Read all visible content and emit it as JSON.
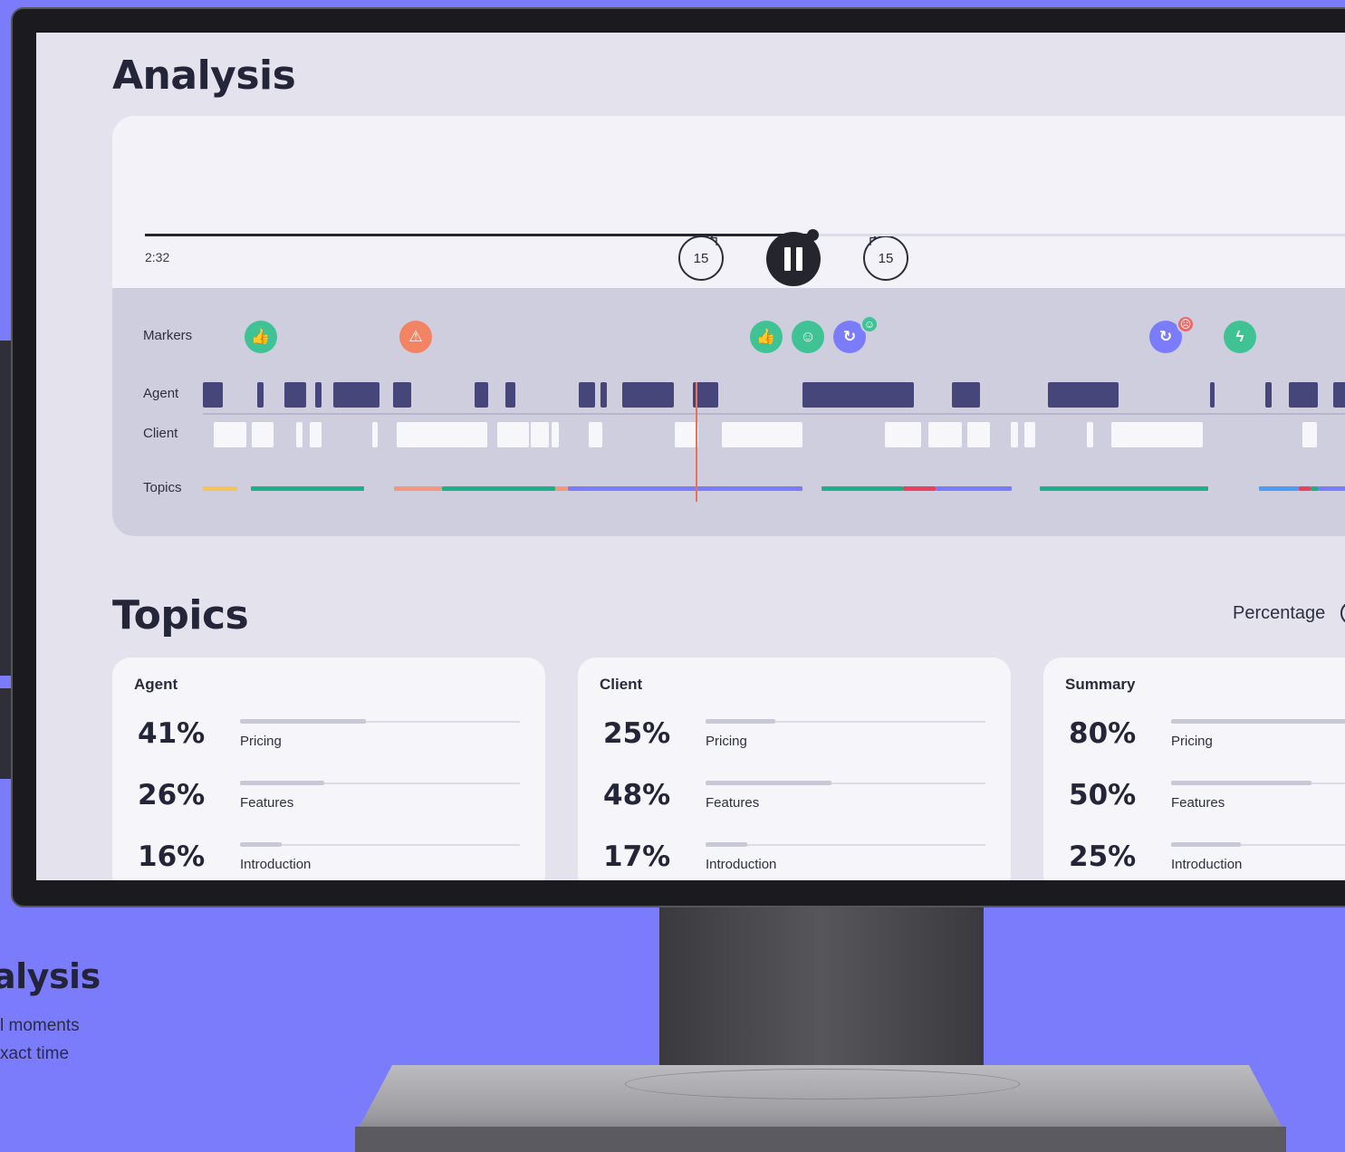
{
  "promo": {
    "title": "alysis",
    "lines": [
      "l moments",
      "xact time"
    ]
  },
  "page": {
    "title": "Analysis"
  },
  "player": {
    "skip_back_label": "15",
    "skip_forward_label": "15",
    "current_time": "2:32",
    "progress": 0.55
  },
  "timeline": {
    "labels": {
      "markers": "Markers",
      "agent": "Agent",
      "client": "Client",
      "topics": "Topics"
    },
    "markers": [
      {
        "icon": "thumbs-up-icon",
        "glyph": "👍",
        "color": "#3fc394"
      },
      {
        "icon": "warning-icon",
        "glyph": "⚠",
        "color": "#f38463"
      },
      {
        "icon": "thumbs-up-icon",
        "glyph": "👍",
        "color": "#3fc394"
      },
      {
        "icon": "happy-face-icon",
        "glyph": "☺",
        "color": "#3fc394"
      },
      {
        "icon": "sync-happy-icon",
        "glyph": "↻",
        "color": "#7b7cfb",
        "badge": "☺",
        "badge_color": "#3fc394"
      },
      {
        "icon": "sync-sad-icon",
        "glyph": "↻",
        "color": "#7b7cfb",
        "badge": "☹",
        "badge_color": "#f06565"
      },
      {
        "icon": "lightning-icon",
        "glyph": "ϟ",
        "color": "#3fc394"
      }
    ],
    "topic_colors": {
      "yellow": "#f4c35a",
      "green": "#20b088",
      "salmon": "#f4977a",
      "purple": "#7b7cfb",
      "red": "#e8415f",
      "blue": "#4d9df5"
    }
  },
  "topics": {
    "title": "Topics",
    "toggle_label": "Percentage",
    "cards": [
      {
        "title": "Agent",
        "stats": [
          {
            "value": "41%",
            "label": "Pricing",
            "fill": 0.45
          },
          {
            "value": "26%",
            "label": "Features",
            "fill": 0.3
          },
          {
            "value": "16%",
            "label": "Introduction",
            "fill": 0.15
          }
        ]
      },
      {
        "title": "Client",
        "stats": [
          {
            "value": "25%",
            "label": "Pricing",
            "fill": 0.25
          },
          {
            "value": "48%",
            "label": "Features",
            "fill": 0.45
          },
          {
            "value": "17%",
            "label": "Introduction",
            "fill": 0.15
          }
        ]
      },
      {
        "title": "Summary",
        "stats": [
          {
            "value": "80%",
            "label": "Pricing",
            "fill": 0.8
          },
          {
            "value": "50%",
            "label": "Features",
            "fill": 0.5
          },
          {
            "value": "25%",
            "label": "Introduction",
            "fill": 0.25
          }
        ]
      }
    ]
  }
}
